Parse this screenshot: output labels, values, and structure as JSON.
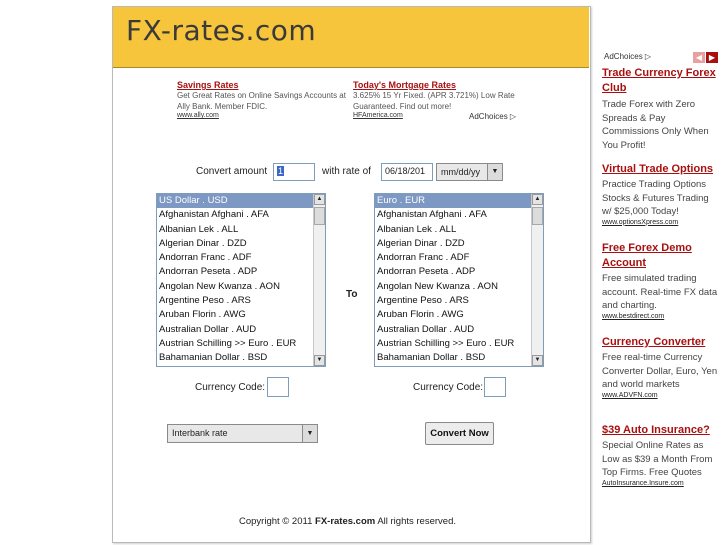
{
  "site": {
    "logo": "FX-rates.com"
  },
  "top_ads": [
    {
      "title": "Savings Rates",
      "text": "Get Great Rates on Online Savings Accounts at Ally Bank. Member FDIC.",
      "url": "www.ally.com"
    },
    {
      "title": "Today's Mortgage Rates",
      "text": "3.625% 15 Yr Fixed. (APR 3.721%) Low Rate Guaranteed. Find out more!",
      "url": "HFAmerica.com"
    }
  ],
  "adchoices": "AdChoices",
  "form": {
    "convert_label": "Convert amount",
    "amount_value": "1",
    "rate_label": "with rate of",
    "date_value": "06/18/201",
    "date_format": "mm/dd/yy",
    "to_label": "To",
    "code_label": "Currency Code:",
    "rate_type": "Interbank rate",
    "convert_button": "Convert Now"
  },
  "from_currencies": [
    "US Dollar . USD",
    "Afghanistan Afghani . AFA",
    "Albanian Lek . ALL",
    "Algerian Dinar . DZD",
    "Andorran Franc . ADF",
    "Andorran Peseta . ADP",
    "Angolan New Kwanza . AON",
    "Argentine Peso . ARS",
    "Aruban Florin . AWG",
    "Australian Dollar . AUD",
    "Austrian Schilling >> Euro . EUR",
    "Bahamanian Dollar . BSD"
  ],
  "to_currencies": [
    "Euro . EUR",
    "Afghanistan Afghani . AFA",
    "Albanian Lek . ALL",
    "Algerian Dinar . DZD",
    "Andorran Franc . ADF",
    "Andorran Peseta . ADP",
    "Angolan New Kwanza . AON",
    "Argentine Peso . ARS",
    "Aruban Florin . AWG",
    "Australian Dollar . AUD",
    "Austrian Schilling >> Euro . EUR",
    "Bahamanian Dollar . BSD"
  ],
  "footer": {
    "prefix": "Copyright © 2011 ",
    "brand": "FX-rates.com",
    "suffix": " All rights reserved."
  },
  "side_ads": {
    "adchoices": "AdChoices",
    "items": [
      {
        "title": "Trade Currency Forex Club",
        "text": "Trade Forex with Zero Spreads & Pay Commissions Only When You Profit!",
        "url": ""
      },
      {
        "title": "Virtual Trade Options",
        "text": "Practice Trading Options Stocks & Futures Trading w/ $25,000 Today!",
        "url": "www.optionsXpress.com"
      },
      {
        "title": "Free Forex Demo Account",
        "text": "Free simulated trading account. Real-time FX data and charting.",
        "url": "www.bestdirect.com"
      },
      {
        "title": "Currency Converter",
        "text": "Free real-time Currency Converter Dollar, Euro, Yen and world markets",
        "url": "www.ADVFN.com"
      },
      {
        "title": "$39 Auto Insurance?",
        "text": "Special Online Rates as Low as $39 a Month From Top Firms. Free Quotes",
        "url": "AutoInsurance.Insure.com"
      }
    ]
  },
  "colors": {
    "header": "#f6c53b",
    "ad_link": "#a81010",
    "selection": "#7d98c3"
  }
}
